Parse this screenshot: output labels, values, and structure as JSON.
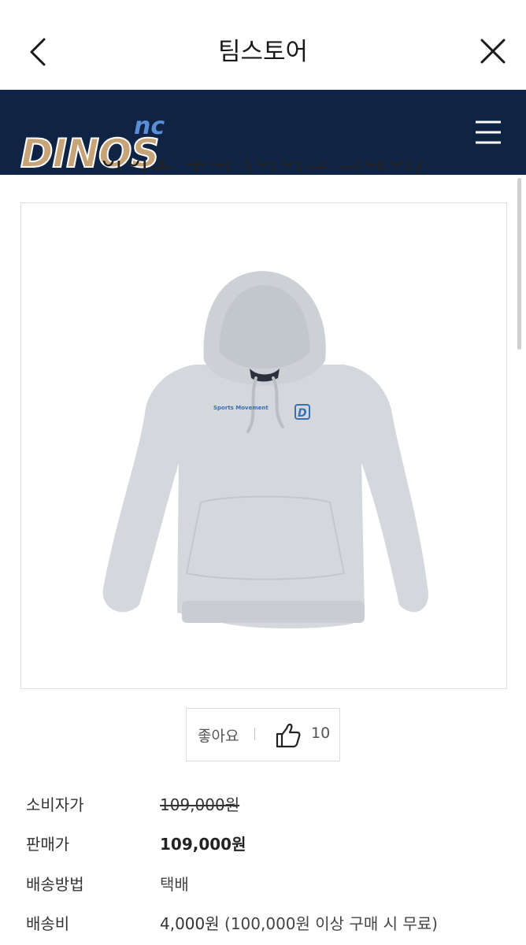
{
  "header": {
    "title": "팀스토어",
    "back_icon": "chevron-left-icon",
    "close_icon": "close-icon"
  },
  "brand": {
    "logo_text": "DINOS",
    "logo_superscript": "nc",
    "menu_icon": "hamburger-menu-icon",
    "bar_color": "#0f2445",
    "logo_gold": "#c7a477",
    "logo_blue": "#5a8fd6"
  },
  "product": {
    "title_partial": "아이오 후디 (아이크 그레이)",
    "image_icon": "gray-hoodie-image",
    "print_text": "Sports Movement"
  },
  "like": {
    "label": "좋아요",
    "count": "10",
    "icon": "thumbs-up-icon"
  },
  "info": {
    "rows": [
      {
        "label": "소비자가",
        "value": "109,000원"
      },
      {
        "label": "판매가",
        "value": "109,000원"
      },
      {
        "label": "배송방법",
        "value": "택배"
      },
      {
        "label": "배송비",
        "value_bold": "4,000원",
        "value_note": " (100,000원 이상 구매 시 무료)"
      }
    ]
  }
}
